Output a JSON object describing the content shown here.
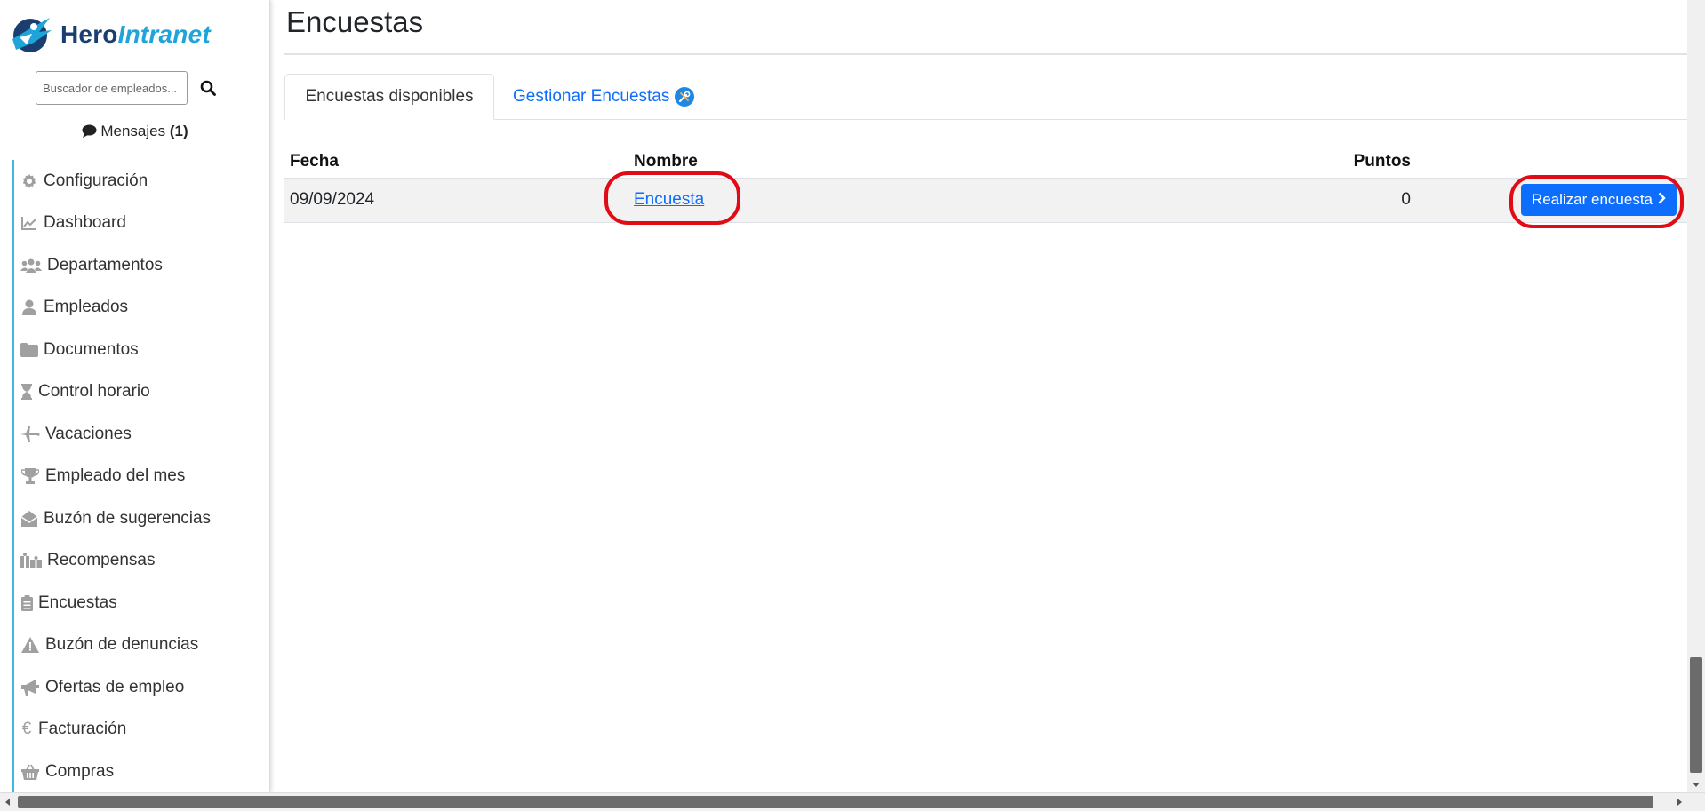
{
  "app": {
    "logo_text_part1": "Hero",
    "logo_text_part2": "Intranet"
  },
  "sidebar": {
    "search": {
      "placeholder": "Buscador de empleados...",
      "value": ""
    },
    "messages": {
      "label": "Mensajes",
      "count": "(1)"
    },
    "items": [
      {
        "label": "Configuración",
        "icon": "gear-icon"
      },
      {
        "label": "Dashboard",
        "icon": "chart-line-icon"
      },
      {
        "label": "Departamentos",
        "icon": "users-icon"
      },
      {
        "label": "Empleados",
        "icon": "user-icon"
      },
      {
        "label": "Documentos",
        "icon": "folder-icon"
      },
      {
        "label": "Control horario",
        "icon": "hourglass-icon"
      },
      {
        "label": "Vacaciones",
        "icon": "plane-icon"
      },
      {
        "label": "Empleado del mes",
        "icon": "trophy-icon"
      },
      {
        "label": "Buzón de sugerencias",
        "icon": "envelope-open-icon"
      },
      {
        "label": "Recompensas",
        "icon": "gifts-icon"
      },
      {
        "label": "Encuestas",
        "icon": "clipboard-list-icon"
      },
      {
        "label": "Buzón de denuncias",
        "icon": "warning-icon"
      },
      {
        "label": "Ofertas de empleo",
        "icon": "megaphone-icon"
      },
      {
        "label": "Facturación",
        "icon": "euro-icon"
      },
      {
        "label": "Compras",
        "icon": "basket-icon"
      }
    ]
  },
  "main": {
    "title": "Encuestas",
    "tabs": [
      {
        "label": "Encuestas disponibles",
        "active": true
      },
      {
        "label": "Gestionar Encuestas",
        "active": false,
        "icon": "tools-icon"
      }
    ],
    "table": {
      "headers": [
        "Fecha",
        "Nombre",
        "Puntos"
      ],
      "rows": [
        {
          "fecha": "09/09/2024",
          "nombre": "Encuesta",
          "puntos": "0",
          "action": "Realizar encuesta"
        }
      ]
    }
  },
  "colors": {
    "accent": "#0d6efd",
    "sidebar_border": "#3fb8e6",
    "highlight": "#e10b17",
    "logo_dark": "#1a3e6f",
    "logo_light": "#1fa4d9"
  }
}
